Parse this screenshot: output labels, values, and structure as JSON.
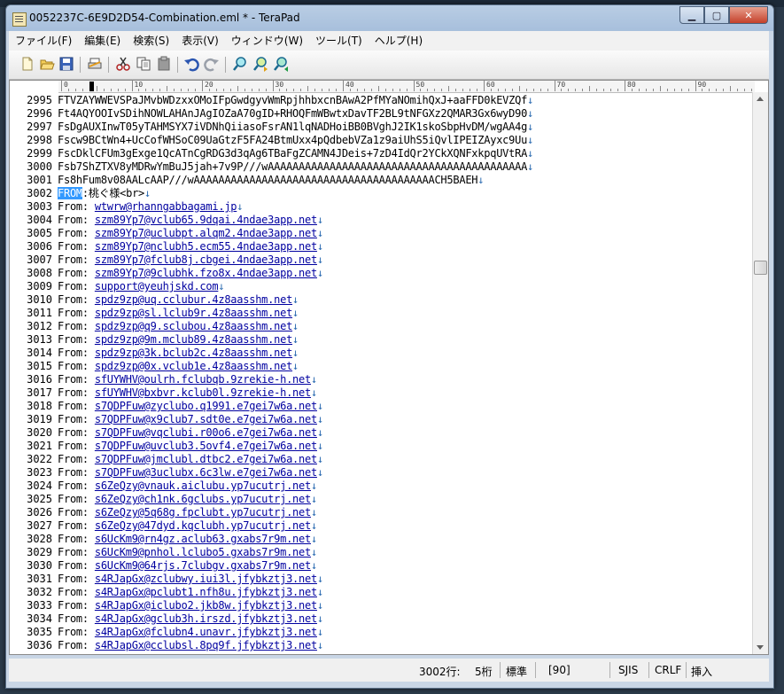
{
  "window": {
    "title": "0052237C-6E9D2D54-Combination.eml * - TeraPad"
  },
  "menu": [
    "ファイル(F)",
    "編集(E)",
    "検索(S)",
    "表示(V)",
    "ウィンドウ(W)",
    "ツール(T)",
    "ヘルプ(H)"
  ],
  "ruler": {
    "marks": [
      "0",
      "10",
      "20",
      "30",
      "40",
      "50",
      "60",
      "70",
      "80",
      "90"
    ]
  },
  "editor": {
    "lines": [
      {
        "n": "2995",
        "text": "FTVZAYWWEVSPaJMvbWDzxxOMoIFpGwdgyvWmRpjhhbxcnBAwA2PfMYaNOmihQxJ+aaFFD0kEVZQf",
        "crlf": "↓"
      },
      {
        "n": "2996",
        "text": "Ft4AQYOOIvSDihNOWLAHAnJAgIOZaA70gID+RHOQFmWBwtxDavTF2BL9tNFGXz2QMAR3Gx6wyD90",
        "crlf": "↓"
      },
      {
        "n": "2997",
        "text": "FsDgAUXInwT05yTAHMSYX7iVDNhQiiasoFsrAN1lqNADHoiBB0BVghJ2IK1skoSbpHvDM/wgAA4g",
        "crlf": "↓"
      },
      {
        "n": "2998",
        "text": "Fscw9BCtWn4+UcCofWHSoC09UaGtzF5FA24BtmUxx4pQdbebVZa1z9aiUhS5iQvlIPEIZAyxc9Uu",
        "crlf": "↓"
      },
      {
        "n": "2999",
        "text": "FscDklCFUm3gExge1QcATnCgRDG3d3qAg6TBaFgZCAMN4JDeis+7zD4IdQr2YCkXQNFxkpqUVtRA",
        "crlf": "↓"
      },
      {
        "n": "3000",
        "text": "Fsb7ShZTXV8yMDRwYmBuJ5jah+7v9P///wAAAAAAAAAAAAAAAAAAAAAAAAAAAAAAAAAAAAAAAAAA",
        "crlf": "↓"
      },
      {
        "n": "3001",
        "text": "Fs8hFum8v08AALcAAP///wAAAAAAAAAAAAAAAAAAAAAAAAAAAAAAAAAAAAAAACH5BAEH",
        "crlf": "↓"
      },
      {
        "n": "3002",
        "sel": "FROM",
        "text": ":桃ぐ様<br>",
        "crlf": "↓"
      },
      {
        "n": "3003",
        "pre": "From: ",
        "url": "wtwrw@rhanngabbagami.jp",
        "crlf": "↓"
      },
      {
        "n": "3004",
        "pre": "From: ",
        "url": "szm89Yp7@vclub65.9dqai.4ndae3app.net",
        "crlf": "↓"
      },
      {
        "n": "3005",
        "pre": "From: ",
        "url": "szm89Yp7@uclubpt.alqm2.4ndae3app.net",
        "crlf": "↓"
      },
      {
        "n": "3006",
        "pre": "From: ",
        "url": "szm89Yp7@nclubh5.ecm55.4ndae3app.net",
        "crlf": "↓"
      },
      {
        "n": "3007",
        "pre": "From: ",
        "url": "szm89Yp7@fclub8j.cbgei.4ndae3app.net",
        "crlf": "↓"
      },
      {
        "n": "3008",
        "pre": "From: ",
        "url": "szm89Yp7@9clubhk.fzo8x.4ndae3app.net",
        "crlf": "↓"
      },
      {
        "n": "3009",
        "pre": "From: ",
        "url": "support@yeuhjskd.com",
        "crlf": "↓"
      },
      {
        "n": "3010",
        "pre": "From: ",
        "url": "spdz9zp@uq.cclubur.4z8aasshm.net",
        "crlf": "↓"
      },
      {
        "n": "3011",
        "pre": "From: ",
        "url": "spdz9zp@sl.lclub9r.4z8aasshm.net",
        "crlf": "↓"
      },
      {
        "n": "3012",
        "pre": "From: ",
        "url": "spdz9zp@q9.sclubou.4z8aasshm.net",
        "crlf": "↓"
      },
      {
        "n": "3013",
        "pre": "From: ",
        "url": "spdz9zp@9m.mclub89.4z8aasshm.net",
        "crlf": "↓"
      },
      {
        "n": "3014",
        "pre": "From: ",
        "url": "spdz9zp@3k.bclub2c.4z8aasshm.net",
        "crlf": "↓"
      },
      {
        "n": "3015",
        "pre": "From: ",
        "url": "spdz9zp@0x.vclub1e.4z8aasshm.net",
        "crlf": "↓"
      },
      {
        "n": "3016",
        "pre": "From: ",
        "url": "sfUYWHV@oulrh.fclubqb.9zrekie-h.net",
        "crlf": "↓"
      },
      {
        "n": "3017",
        "pre": "From: ",
        "url": "sfUYWHV@bxbvr.kclub0l.9zrekie-h.net",
        "crlf": "↓"
      },
      {
        "n": "3018",
        "pre": "From: ",
        "url": "s7QDPFuw@zyclubo.q1991.e7gei7w6a.net",
        "crlf": "↓"
      },
      {
        "n": "3019",
        "pre": "From: ",
        "url": "s7QDPFuw@x9club7.sdt0e.e7gei7w6a.net",
        "crlf": "↓"
      },
      {
        "n": "3020",
        "pre": "From: ",
        "url": "s7QDPFuw@vqclubi.r00o6.e7gei7w6a.net",
        "crlf": "↓"
      },
      {
        "n": "3021",
        "pre": "From: ",
        "url": "s7QDPFuw@uvclub3.5ovf4.e7gei7w6a.net",
        "crlf": "↓"
      },
      {
        "n": "3022",
        "pre": "From: ",
        "url": "s7QDPFuw@jmclubl.dtbc2.e7gei7w6a.net",
        "crlf": "↓"
      },
      {
        "n": "3023",
        "pre": "From: ",
        "url": "s7QDPFuw@3uclubx.6c3lw.e7gei7w6a.net",
        "crlf": "↓"
      },
      {
        "n": "3024",
        "pre": "From: ",
        "url": "s6ZeQzy@vnauk.aiclubu.yp7ucutrj.net",
        "crlf": "↓"
      },
      {
        "n": "3025",
        "pre": "From: ",
        "url": "s6ZeQzy@ch1nk.6gclubs.yp7ucutrj.net",
        "crlf": "↓"
      },
      {
        "n": "3026",
        "pre": "From: ",
        "url": "s6ZeQzy@5q68g.fpclubt.yp7ucutrj.net",
        "crlf": "↓"
      },
      {
        "n": "3027",
        "pre": "From: ",
        "url": "s6ZeQzy@47dyd.kqclubh.yp7ucutrj.net",
        "crlf": "↓"
      },
      {
        "n": "3028",
        "pre": "From: ",
        "url": "s6UcKm9@rn4gz.aclub63.gxabs7r9m.net",
        "crlf": "↓"
      },
      {
        "n": "3029",
        "pre": "From: ",
        "url": "s6UcKm9@pnhol.lclubo5.gxabs7r9m.net",
        "crlf": "↓"
      },
      {
        "n": "3030",
        "pre": "From: ",
        "url": "s6UcKm9@64rjs.7clubgv.gxabs7r9m.net",
        "crlf": "↓"
      },
      {
        "n": "3031",
        "pre": "From: ",
        "url": "s4RJapGx@zclubwy.iui3l.jfybkztj3.net",
        "crlf": "↓"
      },
      {
        "n": "3032",
        "pre": "From: ",
        "url": "s4RJapGx@pclubt1.nfh8u.jfybkztj3.net",
        "crlf": "↓"
      },
      {
        "n": "3033",
        "pre": "From: ",
        "url": "s4RJapGx@iclubo2.jkb8w.jfybkztj3.net",
        "crlf": "↓"
      },
      {
        "n": "3034",
        "pre": "From: ",
        "url": "s4RJapGx@gclub3h.irszd.jfybkztj3.net",
        "crlf": "↓"
      },
      {
        "n": "3035",
        "pre": "From: ",
        "url": "s4RJapGx@fclubn4.unavr.jfybkztj3.net",
        "crlf": "↓"
      },
      {
        "n": "3036",
        "pre": "From: ",
        "url": "s4RJapGx@cclubsl.8pq9f.jfybkztj3.net",
        "crlf": "↓"
      }
    ]
  },
  "status": {
    "line": "3002行:",
    "col": "5桁",
    "mode": "標準",
    "value": "[90]",
    "encoding": "SJIS",
    "newline": "CRLF",
    "insert": "挿入"
  },
  "colors": {
    "url": "#0000a0",
    "selection": "#3399ff",
    "crlf_mark": "#2a6ab0"
  },
  "icons": [
    "new-file-icon",
    "open-folder-icon",
    "save-icon",
    "print-icon",
    "cut-icon",
    "copy-icon",
    "paste-icon",
    "undo-icon",
    "redo-icon",
    "search-icon",
    "search-next-icon",
    "search-prev-icon"
  ]
}
